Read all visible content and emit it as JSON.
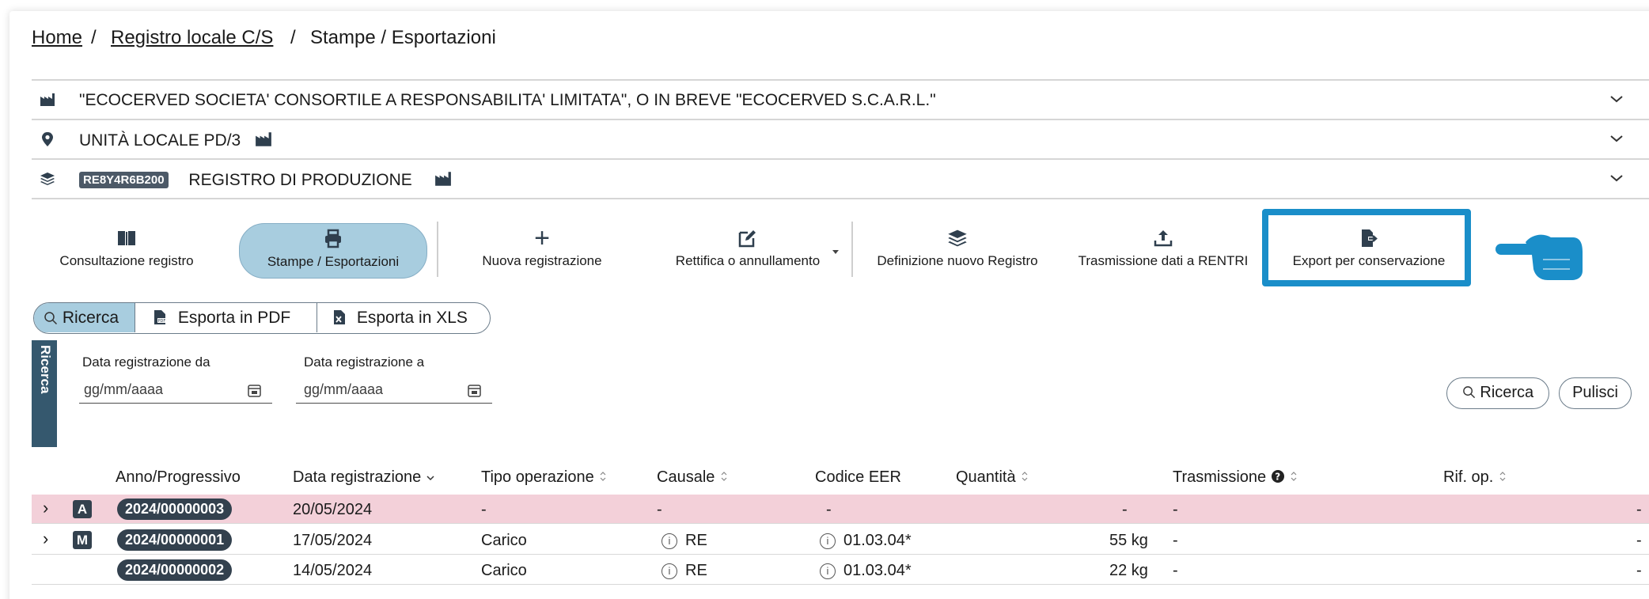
{
  "breadcrumb": {
    "home": "Home",
    "registro": "Registro locale C/S",
    "current": "Stampe / Esportazioni",
    "separator": "/"
  },
  "accordion": {
    "company": "\"ECOCERVED SOCIETA' CONSORTILE A RESPONSABILITA' LIMITATA\", O IN BREVE \"ECOCERVED S.C.A.R.L.\"",
    "unit": "UNITÀ LOCALE PD/3",
    "register_code": "RE8Y4R6B200",
    "register": "REGISTRO DI PRODUZIONE"
  },
  "toolbar": {
    "consultazione": "Consultazione registro",
    "stampe": "Stampe / Esportazioni",
    "nuova": "Nuova registrazione",
    "rettifica": "Rettifica o annullamento",
    "definizione": "Definizione nuovo Registro",
    "trasmissione": "Trasmissione dati a RENTRI",
    "export": "Export per conservazione",
    "plus_glyph": "+"
  },
  "subtabs": {
    "ricerca": "Ricerca",
    "pdf": "Esporta in PDF",
    "xls": "Esporta in XLS"
  },
  "search": {
    "side_tab": "Ricerca",
    "from_label": "Data registrazione da",
    "to_label": "Data registrazione a",
    "placeholder": "gg/mm/aaaa",
    "search_button": "Ricerca",
    "clear_button": "Pulisci"
  },
  "table": {
    "headers": {
      "anno": "Anno/Progressivo",
      "data": "Data registrazione",
      "tipo": "Tipo operazione",
      "causale": "Causale",
      "eer": "Codice EER",
      "quantita": "Quantità",
      "trasmissione": "Trasmissione",
      "rif": "Rif. op."
    },
    "rows": [
      {
        "letter": "A",
        "progressivo": "2024/00000003",
        "data": "20/05/2024",
        "tipo": "-",
        "causale": "-",
        "eer": "-",
        "quantita": "-",
        "trasmissione": "-",
        "rif": "-"
      },
      {
        "letter": "M",
        "progressivo": "2024/00000001",
        "data": "17/05/2024",
        "tipo": "Carico",
        "causale": "RE",
        "eer": "01.03.04*",
        "quantita": "55 kg",
        "trasmissione": "-",
        "rif": "-"
      },
      {
        "letter": "",
        "progressivo": "2024/00000002",
        "data": "14/05/2024",
        "tipo": "Carico",
        "causale": "RE",
        "eer": "01.03.04*",
        "quantita": "22 kg",
        "trasmissione": "-",
        "rif": "-"
      }
    ],
    "info_glyph": "i",
    "expand_glyph": "›"
  },
  "colors": {
    "accent_highlight": "#1a8ec9",
    "active_tab": "#a8cddf",
    "dark_badge": "#33414e",
    "pink_row": "#f3d0d9",
    "side_tab": "#35586e"
  },
  "icons": [
    "factory-icon",
    "map-pin-icon",
    "layers-icon",
    "book-icon",
    "printer-icon",
    "plus-icon",
    "edit-icon",
    "upload-icon",
    "export-file-icon",
    "pointing-hand-icon",
    "search-icon",
    "pdf-icon",
    "xls-icon",
    "calendar-icon",
    "chevron-down-icon",
    "info-icon",
    "question-icon",
    "sort-icon"
  ]
}
